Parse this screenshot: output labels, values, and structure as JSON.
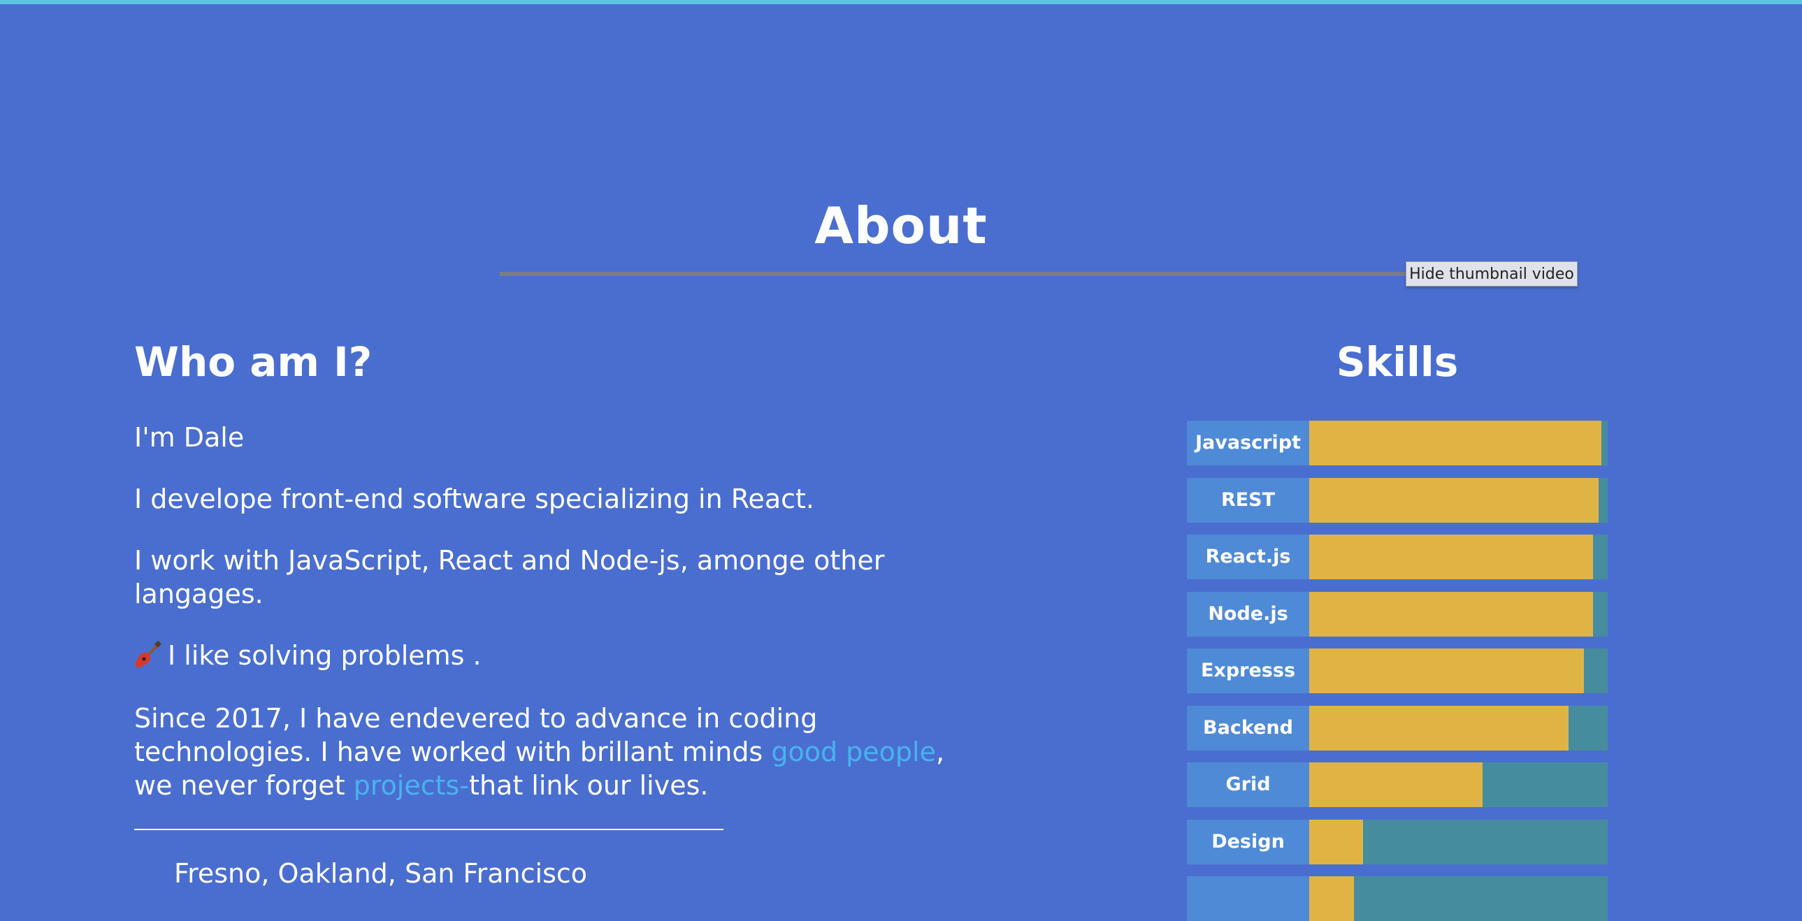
{
  "about": {
    "title": "About"
  },
  "tooltip": {
    "text": "Hide thumbnail video"
  },
  "who": {
    "title": "Who am I?",
    "intro": "I'm Dale",
    "p1": "I develope front-end software specializing in React.",
    "p2": "I work with JavaScript, React and Node-js, amonge other langages.",
    "p3_icon": "guitar-icon",
    "p3_text": "I like solving problems .",
    "p4_part1": "Since 2017, I have endevered to advance in coding technologies. I have worked with brillant minds ",
    "p4_link1": "good people",
    "p4_part2": ", we never forget ",
    "p4_link2": "projects-",
    "p4_part3": "that link our lives.",
    "location": "Fresno, Oakland, San Francisco"
  },
  "skills": {
    "title": "Skills",
    "items": [
      {
        "label": "Javascript",
        "level": 0.98
      },
      {
        "label": "REST",
        "level": 0.97
      },
      {
        "label": "React.js",
        "level": 0.95
      },
      {
        "label": "Node.js",
        "level": 0.95
      },
      {
        "label": "Expresss",
        "level": 0.92
      },
      {
        "label": "Backend",
        "level": 0.87
      },
      {
        "label": "Grid",
        "level": 0.58
      },
      {
        "label": "Design",
        "level": 0.18
      },
      {
        "label": "",
        "level": 0.15
      }
    ]
  },
  "colors": {
    "background": "#4a6ecf",
    "skill_fill": "#e0b444",
    "skill_track": "#468c9f",
    "skill_label_bg": "#4f8ad6",
    "link": "#49b2f0"
  }
}
